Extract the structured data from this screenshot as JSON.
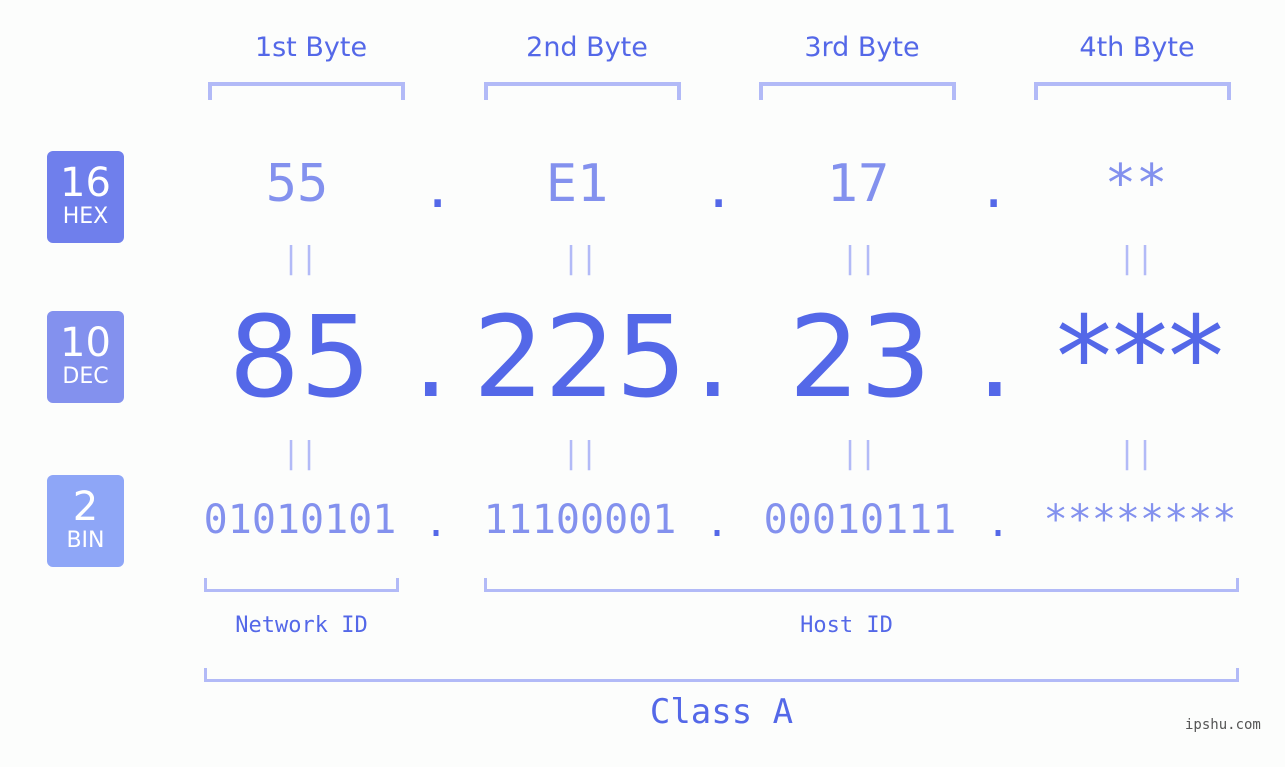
{
  "byte_headers": [
    "1st Byte",
    "2nd Byte",
    "3rd Byte",
    "4th Byte"
  ],
  "badges": {
    "hex": {
      "num": "16",
      "label": "HEX",
      "color": "#6f7fec"
    },
    "dec": {
      "num": "10",
      "label": "DEC",
      "color": "#8391ee"
    },
    "bin": {
      "num": "2",
      "label": "BIN",
      "color": "#8ea6f7"
    }
  },
  "hex": [
    "55",
    "E1",
    "17",
    "**"
  ],
  "dec": [
    "85",
    "225",
    "23",
    "***"
  ],
  "bin": [
    "01010101",
    "11100001",
    "00010111",
    "********"
  ],
  "separator": ".",
  "equals": "||",
  "network_id_label": "Network ID",
  "host_id_label": "Host ID",
  "class_label": "Class A",
  "watermark": "ipshu.com",
  "colors": {
    "accent": "#5468e8",
    "light": "#8391ee",
    "bracket": "#b2baf7"
  }
}
